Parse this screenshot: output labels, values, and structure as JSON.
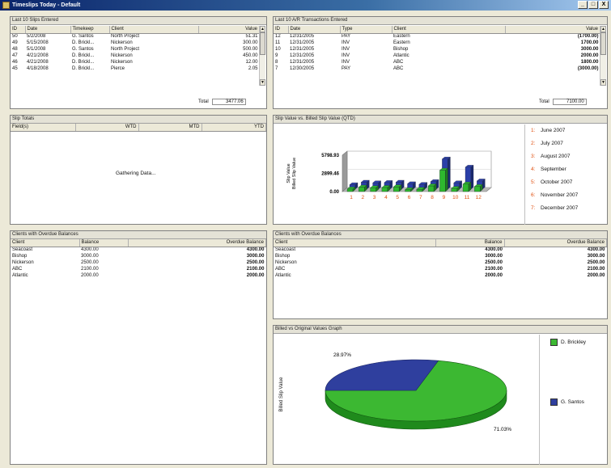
{
  "window": {
    "title": "Timeslips Today - Default"
  },
  "window_buttons": [
    "_",
    "□",
    "X"
  ],
  "slips_panel": {
    "title": "Last 10 Slips Entered",
    "columns": [
      "ID",
      "Date",
      "Timekeep",
      "Client",
      "Value"
    ],
    "rows": [
      [
        "50",
        "5/2/2008",
        "G. Santos",
        "North Project",
        "51.31"
      ],
      [
        "49",
        "5/15/2008",
        "D. Brickl...",
        "Nickerson",
        "300.00"
      ],
      [
        "48",
        "5/1/2008",
        "G. Santos",
        "North Project",
        "500.00"
      ],
      [
        "47",
        "4/21/2008",
        "D. Brickl...",
        "Nickerson",
        "450.00"
      ],
      [
        "46",
        "4/21/2008",
        "D. Brickl...",
        "Nickerson",
        "12.00"
      ],
      [
        "45",
        "4/18/2008",
        "D. Brickl...",
        "Pierce",
        "2.05"
      ]
    ],
    "total_label": "Total",
    "total_value": "3477.06"
  },
  "ar_panel": {
    "title": "Last 10 A/R Transactions Entered",
    "columns": [
      "ID",
      "Date",
      "Type",
      "Client",
      "Value"
    ],
    "rows": [
      [
        "12",
        "12/31/2005",
        "PAY",
        "Eastern",
        "(1700.00)"
      ],
      [
        "11",
        "12/31/2005",
        "INV",
        "Eastern",
        "1700.00"
      ],
      [
        "10",
        "12/31/2005",
        "INV",
        "Bishop",
        "3000.00"
      ],
      [
        "9",
        "12/31/2005",
        "INV",
        "Atlantic",
        "2000.00"
      ],
      [
        "8",
        "12/31/2005",
        "INV",
        "ABC",
        "1800.00"
      ],
      [
        "7",
        "12/30/2005",
        "PAY",
        "ABC",
        "(3000.00)"
      ]
    ],
    "total_label": "Total",
    "total_value": "7100.00"
  },
  "slip_totals_panel": {
    "title": "Slip Totals",
    "columns": [
      "Field(s)",
      "WTD",
      "MTD",
      "YTD"
    ],
    "status": "Gathering Data..."
  },
  "chart_panel": {
    "title": "Slip Value vs. Billed Slip Value (QTD)",
    "ylabel_1": "Slip Value",
    "ylabel_2": "Billed Slip Value",
    "months": [
      {
        "num": "1:",
        "label": "June 2007"
      },
      {
        "num": "2:",
        "label": "July 2007"
      },
      {
        "num": "3:",
        "label": "August 2007"
      },
      {
        "num": "4:",
        "label": "September"
      },
      {
        "num": "5:",
        "label": "October 2007"
      },
      {
        "num": "6:",
        "label": "November 2007"
      },
      {
        "num": "7:",
        "label": "December 2007"
      }
    ]
  },
  "chart_data": [
    {
      "type": "bar",
      "title": "Slip Value vs. Billed Slip Value (QTD)",
      "categories": [
        "1",
        "2",
        "3",
        "4",
        "5",
        "6",
        "7",
        "8",
        "9",
        "10",
        "11",
        "12"
      ],
      "y_ticks": [
        "5798.93",
        "2899.46",
        "0.00"
      ],
      "ylim": [
        0,
        5798.93
      ],
      "series": [
        {
          "name": "Slip Value",
          "color": "#2a3fa8",
          "values": [
            700,
            1100,
            1000,
            1050,
            1100,
            850,
            750,
            1200,
            4800,
            1000,
            3500,
            1300
          ]
        },
        {
          "name": "Billed Slip Value",
          "color": "#2eb82e",
          "values": [
            400,
            700,
            600,
            650,
            750,
            300,
            350,
            900,
            3400,
            500,
            1200,
            800
          ]
        }
      ]
    },
    {
      "type": "pie",
      "title": "Billed vs Original Values Graph",
      "ylabel": "Billed Slip Value",
      "labels": [
        "D. Brickley",
        "G. Santos"
      ],
      "values": [
        71.03,
        28.97
      ],
      "value_labels": [
        "71.03%",
        "28.97%"
      ],
      "colors": [
        "#3cb832",
        "#2f3f9e"
      ]
    }
  ],
  "overdue_left": {
    "title": "Clients with Overdue Balances",
    "columns": [
      "Client",
      "Balance",
      "Overdue Balance"
    ],
    "rows": [
      [
        "Seacoast",
        "4300.00",
        "4300.00"
      ],
      [
        "Bishop",
        "3000.00",
        "3000.00"
      ],
      [
        "Nickerson",
        "2500.00",
        "2500.00"
      ],
      [
        "ABC",
        "2100.00",
        "2100.00"
      ],
      [
        "Atlantic",
        "2000.00",
        "2000.00"
      ]
    ]
  },
  "overdue_right": {
    "title": "Clients with Overdue Balances",
    "columns": [
      "Client",
      "Balance",
      "Overdue Balance"
    ],
    "rows": [
      [
        "Seacoast",
        "4300.00",
        "4300.00"
      ],
      [
        "Bishop",
        "3000.00",
        "3000.00"
      ],
      [
        "Nickerson",
        "2500.00",
        "2500.00"
      ],
      [
        "ABC",
        "2100.00",
        "2100.00"
      ],
      [
        "Atlantic",
        "2000.00",
        "2000.00"
      ]
    ]
  },
  "pie_panel": {
    "title": "Billed vs Original Values Graph",
    "ylabel": "Billed Slip Value",
    "legend": [
      {
        "label": "D. Brickley",
        "color": "#3cb832"
      },
      {
        "label": "G. Santos",
        "color": "#2f3f9e"
      }
    ],
    "label_a": "28.97%",
    "label_b": "71.03%"
  }
}
